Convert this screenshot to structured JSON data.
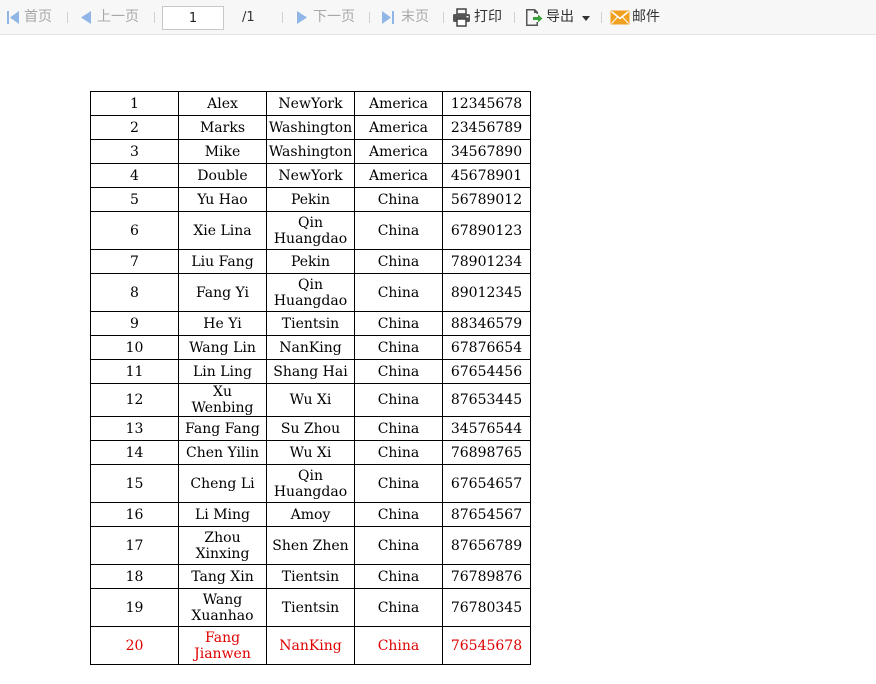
{
  "toolbar": {
    "first_label": "首页",
    "prev_label": "上一页",
    "page_value": "1",
    "page_total": "/1",
    "next_label": "下一页",
    "last_label": "末页",
    "print_label": "打印",
    "export_label": "导出",
    "mail_label": "邮件"
  },
  "table": {
    "rows": [
      {
        "no": "1",
        "name": "Alex",
        "city": "NewYork",
        "country": "America",
        "phone": "12345678"
      },
      {
        "no": "2",
        "name": "Marks",
        "city": "Washington",
        "country": "America",
        "phone": "23456789"
      },
      {
        "no": "3",
        "name": "Mike",
        "city": "Washington",
        "country": "America",
        "phone": "34567890"
      },
      {
        "no": "4",
        "name": "Double",
        "city": "NewYork",
        "country": "America",
        "phone": "45678901"
      },
      {
        "no": "5",
        "name": "Yu Hao",
        "city": "Pekin",
        "country": "China",
        "phone": "56789012"
      },
      {
        "no": "6",
        "name": "Xie Lina",
        "city": "Qin Huangdao",
        "country": "China",
        "phone": "67890123"
      },
      {
        "no": "7",
        "name": "Liu Fang",
        "city": "Pekin",
        "country": "China",
        "phone": "78901234"
      },
      {
        "no": "8",
        "name": "Fang Yi",
        "city": "Qin Huangdao",
        "country": "China",
        "phone": "89012345"
      },
      {
        "no": "9",
        "name": "He Yi",
        "city": "Tientsin",
        "country": "China",
        "phone": "88346579"
      },
      {
        "no": "10",
        "name": "Wang Lin",
        "city": "NanKing",
        "country": "China",
        "phone": "67876654"
      },
      {
        "no": "11",
        "name": "Lin Ling",
        "city": "Shang Hai",
        "country": "China",
        "phone": "67654456"
      },
      {
        "no": "12",
        "name": "Xu Wenbing",
        "city": "Wu Xi",
        "country": "China",
        "phone": "87653445"
      },
      {
        "no": "13",
        "name": "Fang Fang",
        "city": "Su Zhou",
        "country": "China",
        "phone": "34576544"
      },
      {
        "no": "14",
        "name": "Chen Yilin",
        "city": "Wu Xi",
        "country": "China",
        "phone": "76898765"
      },
      {
        "no": "15",
        "name": "Cheng Li",
        "city": "Qin Huangdao",
        "country": "China",
        "phone": "67654657"
      },
      {
        "no": "16",
        "name": "Li Ming",
        "city": "Amoy",
        "country": "China",
        "phone": "87654567"
      },
      {
        "no": "17",
        "name": "Zhou Xinxing",
        "city": "Shen Zhen",
        "country": "China",
        "phone": "87656789"
      },
      {
        "no": "18",
        "name": "Tang Xin",
        "city": "Tientsin",
        "country": "China",
        "phone": "76789876"
      },
      {
        "no": "19",
        "name": "Wang Xuanhao",
        "city": "Tientsin",
        "country": "China",
        "phone": "76780345"
      },
      {
        "no": "20",
        "name": "Fang Jianwen",
        "city": "NanKing",
        "country": "China",
        "phone": "76545678"
      }
    ]
  },
  "colors": {
    "highlight_row_text": "#e00000",
    "toolbar_disabled": "#a8a8a8",
    "nav_icon": "#8fb6e6",
    "print_icon": "#444444",
    "export_icon": "#3aa13a",
    "mail_icon": "#f0a020"
  }
}
